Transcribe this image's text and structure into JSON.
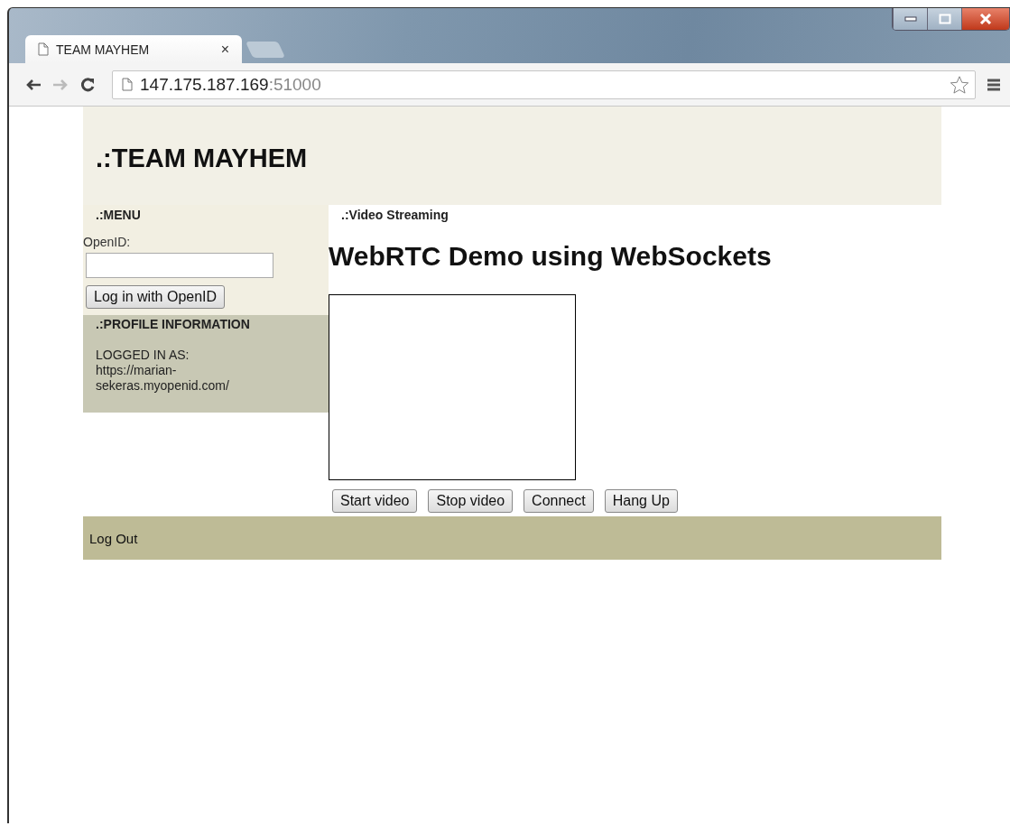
{
  "browser": {
    "tab_title": "TEAM MAYHEM",
    "tab_close": "×",
    "url_host": "147.175.187.169",
    "url_port": ":51000"
  },
  "header": {
    "title": ".:TEAM MAYHEM"
  },
  "sidebar": {
    "menu_heading": ".:MENU",
    "openid_label": "OpenID:",
    "login_button": "Log in with OpenID",
    "profile_heading": ".:PROFILE INFORMATION",
    "logged_in_label": "LOGGED IN AS:",
    "logged_in_url": "https://marian-sekeras.myopenid.com/"
  },
  "main": {
    "section_heading": ".:Video Streaming",
    "title": "WebRTC Demo using WebSockets",
    "buttons": [
      "Start video",
      "Stop video",
      "Connect",
      "Hang Up"
    ]
  },
  "footer": {
    "link": "Log Out"
  }
}
